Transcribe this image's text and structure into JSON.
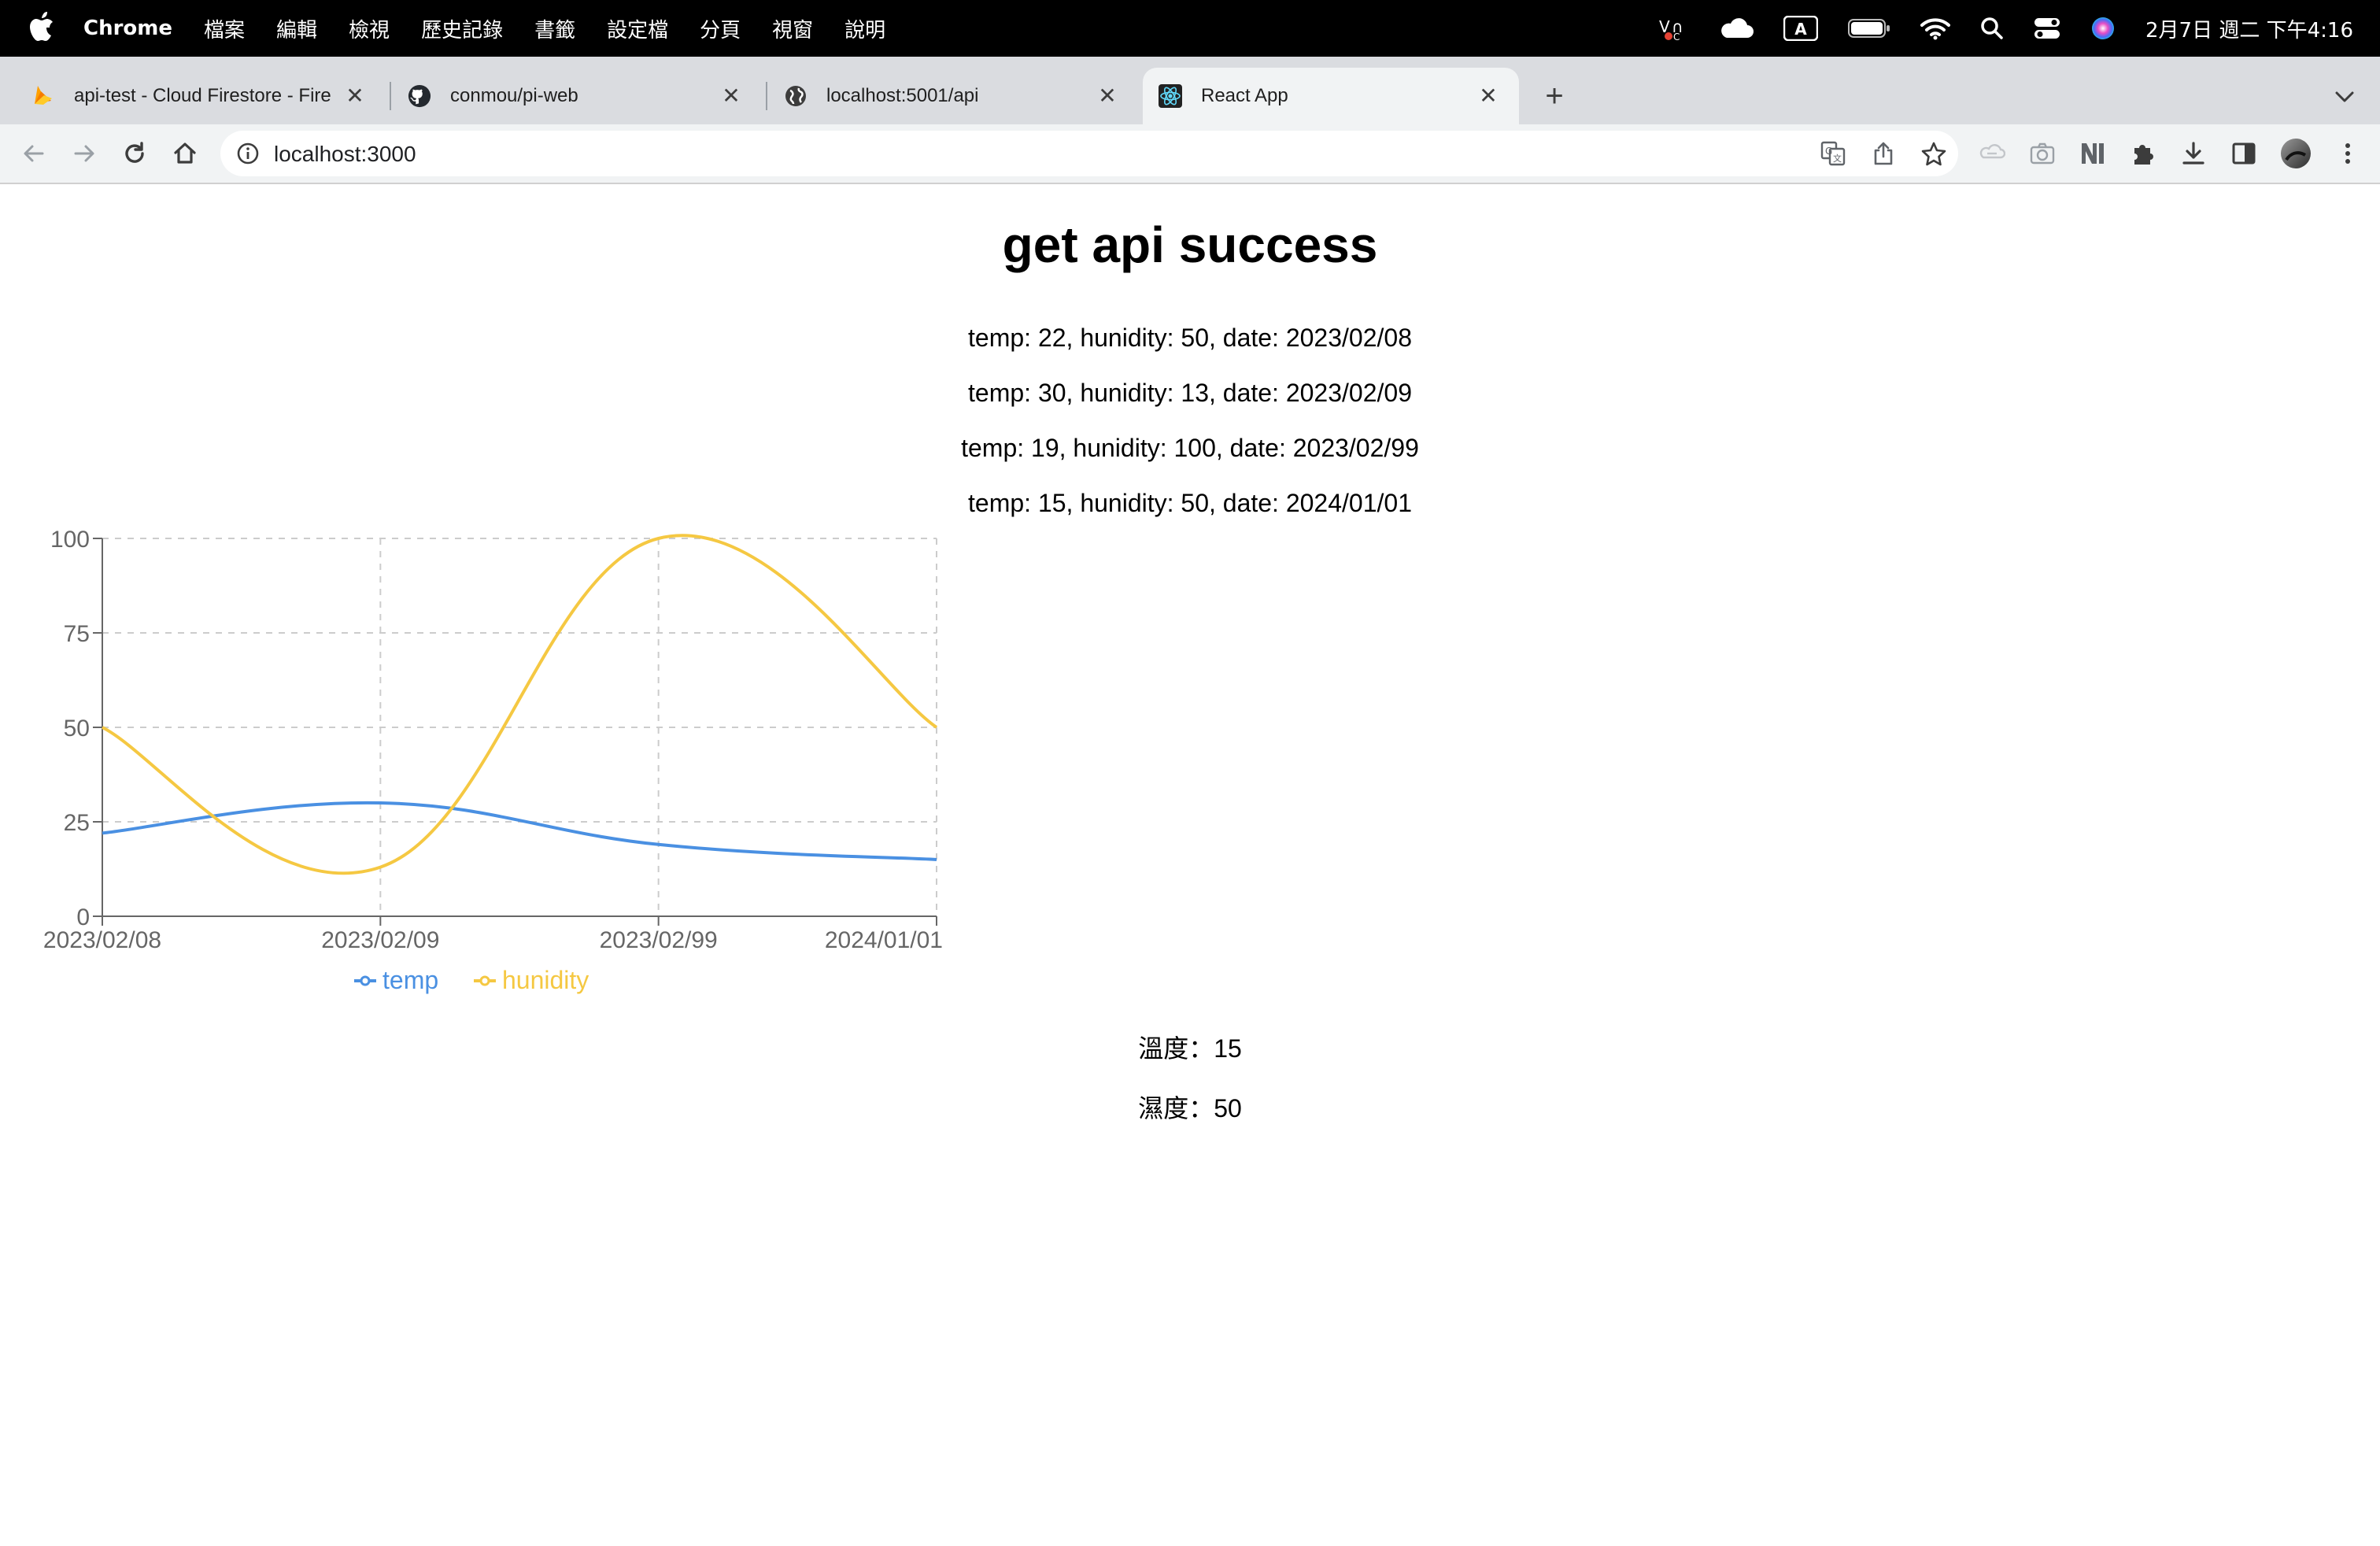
{
  "menubar": {
    "app_name": "Chrome",
    "menus": [
      "檔案",
      "編輯",
      "檢視",
      "歷史記錄",
      "書籤",
      "設定檔",
      "分頁",
      "視窗",
      "說明"
    ],
    "clock": "2月7日 週二  下午4:16",
    "status_icons": [
      "vpn-icon",
      "cloud-icon",
      "input-method-icon",
      "battery-icon",
      "wifi-icon",
      "spotlight-search-icon",
      "control-center-icon",
      "siri-icon"
    ],
    "input_method_label": "A"
  },
  "tabs": [
    {
      "title": "api-test - Cloud Firestore - Fire",
      "icon": "firebase-icon",
      "active": false
    },
    {
      "title": "conmou/pi-web",
      "icon": "github-icon",
      "active": false
    },
    {
      "title": "localhost:5001/api",
      "icon": "globe-icon",
      "active": false
    },
    {
      "title": "React App",
      "icon": "react-icon",
      "active": true
    }
  ],
  "toolbar": {
    "url": "localhost:3000"
  },
  "page": {
    "heading": "get api success",
    "records": [
      "temp: 22, hunidity: 50, date: 2023/02/08",
      "temp: 30, hunidity: 13, date: 2023/02/09",
      "temp: 19, hunidity: 100, date: 2023/02/99",
      "temp: 15, hunidity: 50, date: 2024/01/01"
    ],
    "current_temp": "溫度：15",
    "current_humidity": "濕度：50"
  },
  "chart_data": {
    "type": "line",
    "categories": [
      "2023/02/08",
      "2023/02/09",
      "2023/02/99",
      "2024/01/01"
    ],
    "series": [
      {
        "name": "temp",
        "values": [
          22,
          30,
          19,
          15
        ],
        "color": "#4a90e2"
      },
      {
        "name": "hunidity",
        "values": [
          50,
          13,
          100,
          50
        ],
        "color": "#f5c842"
      }
    ],
    "yticks": [
      0,
      25,
      50,
      75,
      100
    ],
    "ylim": [
      0,
      100
    ],
    "grid": true,
    "legend_position": "bottom-center"
  }
}
